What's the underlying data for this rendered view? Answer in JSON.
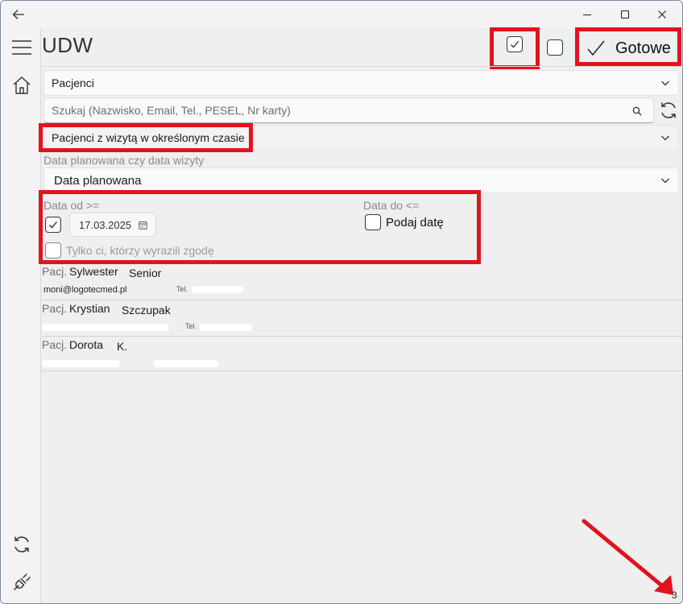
{
  "app": {
    "title": "UDW"
  },
  "header": {
    "done_label": "Gotowe"
  },
  "patients_dropdown": {
    "value": "Pacjenci"
  },
  "search": {
    "placeholder": "Szukaj (Nazwisko, Email, Tel., PESEL, Nr karty)"
  },
  "filter_dropdown": {
    "value": "Pacjenci z wizytą w określonym czasie"
  },
  "date_type": {
    "label": "Data planowana czy data wizyty",
    "value": "Data planowana"
  },
  "date_from": {
    "label": "Data od >=",
    "checked": true,
    "value": "17.03.2025"
  },
  "date_to": {
    "label": "Data do <=",
    "checkbox_label": "Podaj datę"
  },
  "consent": {
    "label": "Tylko ci, którzy wyrazili zgodę"
  },
  "patients": [
    {
      "prefix": "Pacj.",
      "first_name": "Sylwester",
      "last_name": "Senior",
      "email": "moni@logotecmed.pl",
      "phone_label": "Tel."
    },
    {
      "prefix": "Pacj.",
      "first_name": "Krystian",
      "last_name": "Szczupak",
      "phone_label": "Tel."
    },
    {
      "prefix": "Pacj.",
      "first_name": "Dorota",
      "last_name": "K."
    }
  ],
  "footer": {
    "page_count": "3"
  },
  "colors": {
    "highlight": "#e0141e",
    "background": "#efefef"
  },
  "icons": [
    "back-arrow-icon",
    "minimize-icon",
    "maximize-icon",
    "close-icon",
    "hamburger-icon",
    "home-icon",
    "refresh-icon",
    "plug-icon",
    "check-icon",
    "search-icon",
    "calendar-icon",
    "chevron-down-icon"
  ]
}
